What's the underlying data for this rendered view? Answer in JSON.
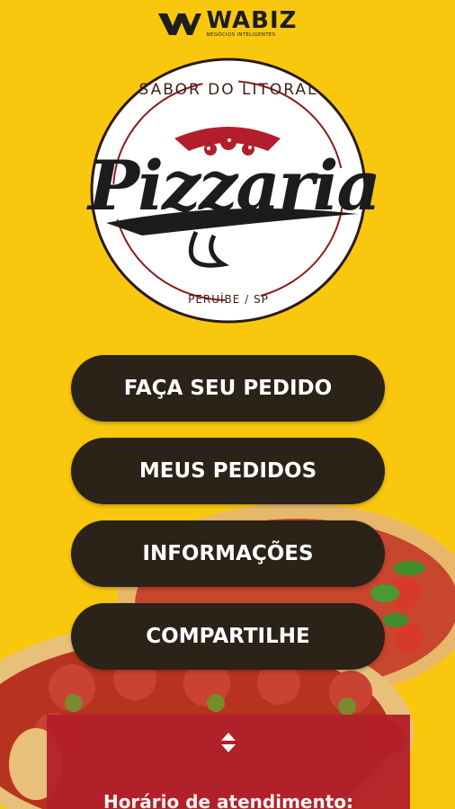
{
  "brand": {
    "name": "WABIZ",
    "subtitle": "NEGÓCIOS INTELIGENTES"
  },
  "logo": {
    "top_text": "SABOR DO LITORAL",
    "script_text": "Pizzaria",
    "bottom_text": "PERUÍBE / SP"
  },
  "menu": {
    "items": [
      {
        "label": "FAÇA SEU PEDIDO"
      },
      {
        "label": "MEUS PEDIDOS"
      },
      {
        "label": "INFORMAÇÕES"
      },
      {
        "label": "COMPARTILHE"
      }
    ]
  },
  "hours": {
    "label": "Horário de atendimento:"
  },
  "colors": {
    "background": "#f9c80e",
    "button": "#2b2218",
    "panel": "#b21f2a"
  }
}
